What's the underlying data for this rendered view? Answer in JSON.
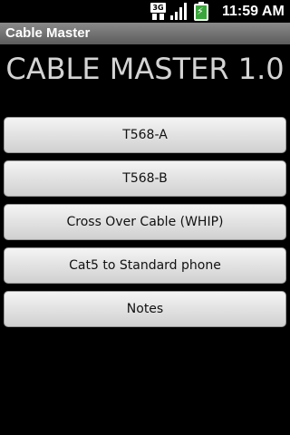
{
  "status_bar": {
    "network_label": "3G",
    "time": "11:59 AM",
    "icons": [
      "3g-data-icon",
      "signal-strength-icon",
      "battery-charging-icon"
    ]
  },
  "app_bar": {
    "title": "Cable Master"
  },
  "main": {
    "heading": "CABLE MASTER 1.0",
    "buttons": [
      {
        "label": "T568-A"
      },
      {
        "label": "T568-B"
      },
      {
        "label": "Cross Over Cable (WHIP)"
      },
      {
        "label": "Cat5 to Standard phone"
      },
      {
        "label": "Notes"
      }
    ]
  },
  "colors": {
    "background": "#000000",
    "title_bar": "#707070",
    "button_face": "#e2e2e2",
    "heading_text": "#d4d4d4",
    "battery_green": "#39a63b"
  }
}
